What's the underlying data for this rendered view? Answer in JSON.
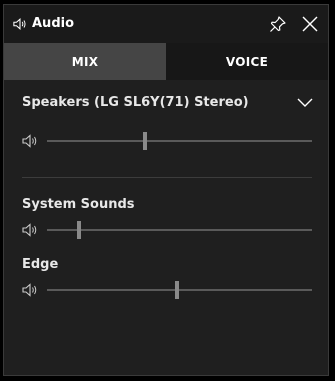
{
  "window": {
    "title": "Audio",
    "title_icon": "speaker-icon",
    "pin_icon": "pin-icon",
    "close_icon": "close-icon"
  },
  "tabs": [
    {
      "label": "MIX",
      "active": true
    },
    {
      "label": "VOICE",
      "active": false
    }
  ],
  "device": {
    "name": "Speakers (LG SL6Y(71) Stereo)",
    "chevron_icon": "chevron-down-icon",
    "volume_level": 0.37
  },
  "apps": [
    {
      "name": "System Sounds",
      "volume_level": 0.12
    },
    {
      "name": "Edge",
      "volume_level": 0.49
    }
  ],
  "colors": {
    "panel_bg": "#1f1f1f",
    "active_tab_bg": "#454545",
    "inactive_tab_bg": "#171717",
    "track": "#5a5a5a",
    "thumb": "#8a8a8a"
  }
}
